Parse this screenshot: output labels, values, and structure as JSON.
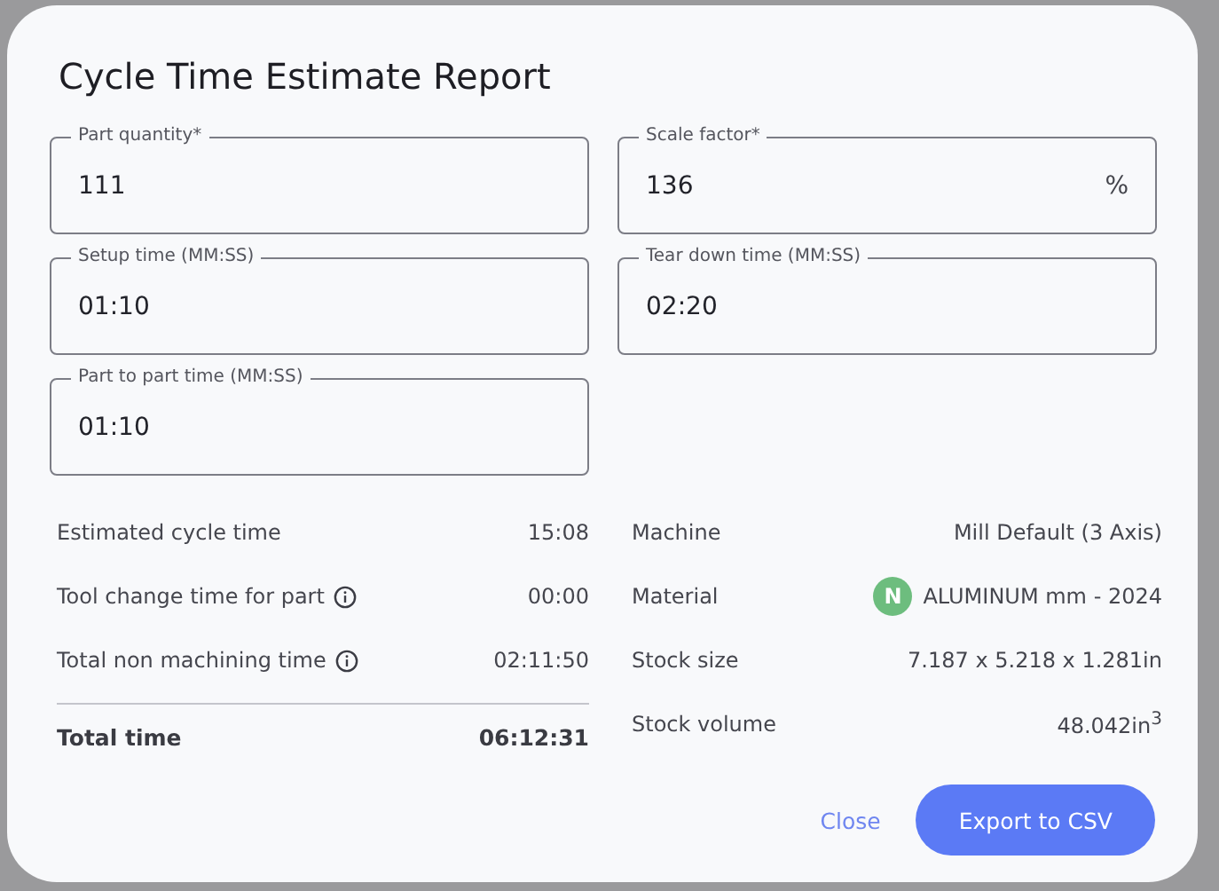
{
  "dialog": {
    "title": "Cycle Time Estimate Report"
  },
  "fields": [
    {
      "label": "Part quantity*",
      "value": "111"
    },
    {
      "label": "Scale factor*",
      "value": "136",
      "suffix": "%"
    },
    {
      "label": "Setup time (MM:SS)",
      "value": "01:10"
    },
    {
      "label": "Tear down time (MM:SS)",
      "value": "02:20"
    },
    {
      "label": "Part to part time (MM:SS)",
      "value": "01:10"
    }
  ],
  "times": [
    {
      "label": "Estimated cycle time",
      "value": "15:08",
      "info": false
    },
    {
      "label": "Tool change time for part",
      "value": "00:00",
      "info": true
    },
    {
      "label": "Total non machining time",
      "value": "02:11:50",
      "info": true
    }
  ],
  "total": {
    "label": "Total time",
    "value": "06:12:31"
  },
  "details": [
    {
      "label": "Machine",
      "value": "Mill Default (3 Axis)"
    },
    {
      "label": "Material",
      "value": "ALUMINUM mm - 2024",
      "badge": "N"
    },
    {
      "label": "Stock size",
      "value": "7.187 x 5.218 x 1.281in"
    },
    {
      "label": "Stock volume",
      "value": "48.042in$^{3}$"
    }
  ],
  "buttons": [
    {
      "label": "Close",
      "kind": "text"
    },
    {
      "label": "Export to CSV",
      "kind": "primary"
    }
  ]
}
